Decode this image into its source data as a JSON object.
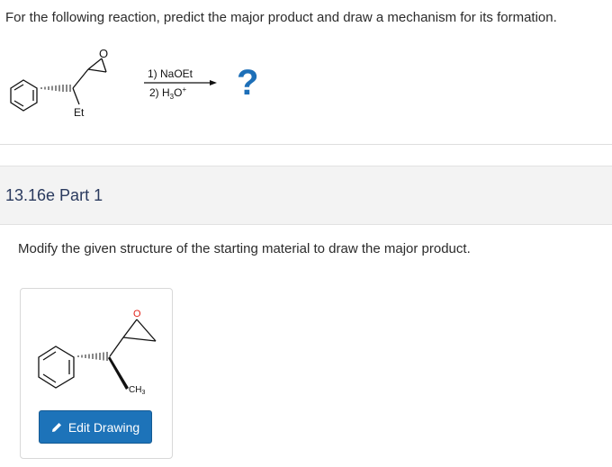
{
  "question": {
    "text": "For the following reaction, predict the major product and draw a mechanism for its formation."
  },
  "reaction": {
    "epoxide_oxygen": "O",
    "substituent": "Et",
    "step1": "1) NaOEt",
    "step2_prefix": "2) H",
    "step2_sub": "3",
    "step2_mid": "O",
    "step2_sup": "+",
    "unknown": "?"
  },
  "part": {
    "title": "13.16e Part 1"
  },
  "instruction": "Modify the given structure of the starting material to draw the major product.",
  "drawing": {
    "oxygen_label": "O",
    "methyl_label_main": "CH",
    "methyl_label_sub": "3",
    "edit_button_label": "Edit Drawing"
  },
  "colors": {
    "question_mark": "#1d6fb8",
    "button_bg": "#1d73b9",
    "oxygen_red": "#e2231a",
    "part_title": "#2a3a5e"
  }
}
